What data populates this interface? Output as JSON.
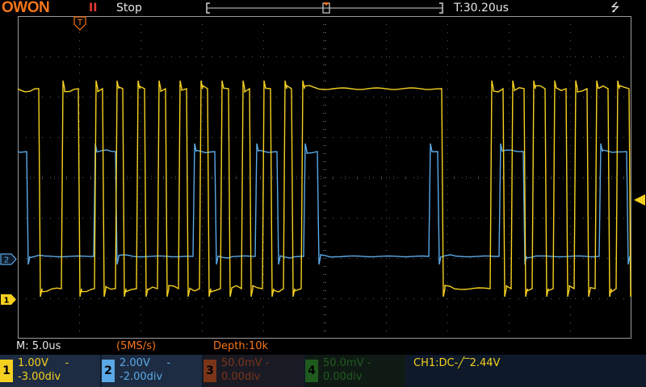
{
  "header": {
    "logo": "OWON",
    "run_icon": "II",
    "status": "Stop",
    "trigger_time": "T:30.20us",
    "usb_icon": "usb-icon"
  },
  "info": {
    "timebase": "M: 5.0us",
    "sample_rate": "(5MS/s)",
    "depth": "Depth:10k"
  },
  "channels": [
    {
      "num": "1",
      "volts": "1.00V",
      "coupling": "-",
      "offset": "-3.00div",
      "color": "#f5d020",
      "bg": "#1d2c42"
    },
    {
      "num": "2",
      "volts": "2.00V",
      "coupling": "-",
      "offset": "-2.00div",
      "color": "#5aa8e6",
      "bg": "#1d2c42"
    },
    {
      "num": "3",
      "volts": "50.0mV",
      "coupling": "-",
      "offset": "0.00div",
      "color": "#7a3418",
      "bg": "#1a1a24"
    },
    {
      "num": "4",
      "volts": "50.0mV",
      "coupling": "-",
      "offset": "0.00div",
      "color": "#1f5a1f",
      "bg": "#101a14"
    }
  ],
  "trigger": {
    "text": "CH1:DC-╱‾2.44V"
  },
  "markers": {
    "trigger_pos": "T",
    "ch1": "1",
    "ch2": "2"
  },
  "colors": {
    "ch1": "#f5d020",
    "ch2": "#5aa8e6",
    "grid": "#5a5a5a",
    "frame": "#9a9a9a",
    "logo": "#f5761a"
  }
}
